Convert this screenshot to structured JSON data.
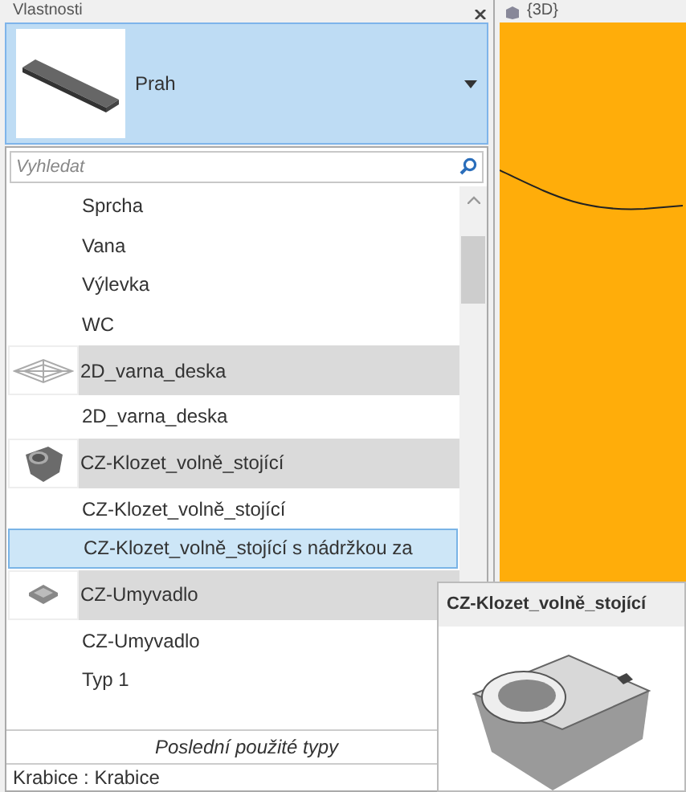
{
  "panel": {
    "title": "Vlastnosti"
  },
  "type_selector": {
    "name": "Prah"
  },
  "search": {
    "placeholder": "Vyhledat"
  },
  "list": [
    {
      "kind": "type",
      "label": "Sprcha",
      "selected": false
    },
    {
      "kind": "type",
      "label": "Vana",
      "selected": false
    },
    {
      "kind": "type",
      "label": "Výlevka",
      "selected": false
    },
    {
      "kind": "type",
      "label": "WC",
      "selected": false
    },
    {
      "kind": "family",
      "label": "2D_varna_deska"
    },
    {
      "kind": "type",
      "label": "2D_varna_deska",
      "selected": false
    },
    {
      "kind": "family",
      "label": "CZ-Klozet_volně_stojící"
    },
    {
      "kind": "type",
      "label": "CZ-Klozet_volně_stojící",
      "selected": false
    },
    {
      "kind": "type",
      "label": "CZ-Klozet_volně_stojící s nádržkou za",
      "selected": true
    },
    {
      "kind": "family",
      "label": "CZ-Umyvadlo"
    },
    {
      "kind": "type",
      "label": "CZ-Umyvadlo",
      "selected": false
    },
    {
      "kind": "type",
      "label": "Typ 1",
      "selected": false
    }
  ],
  "recent_header": "Poslední použité typy",
  "recent": [
    "Krabice : Krabice"
  ],
  "view": {
    "title": "{3D}"
  },
  "tooltip": {
    "title": "CZ-Klozet_volně_stojící"
  }
}
